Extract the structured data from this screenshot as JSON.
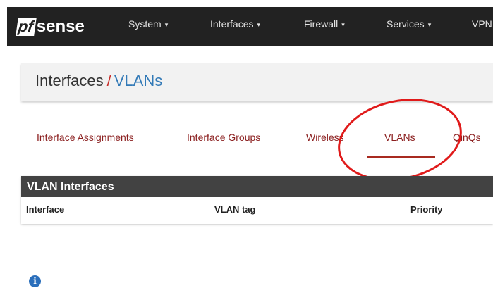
{
  "logo": {
    "part1": "pf",
    "part2": "sense"
  },
  "navbar": {
    "items": [
      {
        "label": "System",
        "has_caret": true
      },
      {
        "label": "Interfaces",
        "has_caret": true
      },
      {
        "label": "Firewall",
        "has_caret": true
      },
      {
        "label": "Services",
        "has_caret": true
      },
      {
        "label": "VPN",
        "has_caret": false
      }
    ],
    "caret": "▾"
  },
  "breadcrumb": {
    "section": "Interfaces",
    "separator": "/",
    "current": "VLANs"
  },
  "tabs": [
    {
      "label": "Interface Assignments",
      "active": false
    },
    {
      "label": "Interface Groups",
      "active": false
    },
    {
      "label": "Wireless",
      "active": false
    },
    {
      "label": "VLANs",
      "active": true
    },
    {
      "label": "QinQs",
      "active": false
    }
  ],
  "panel": {
    "title": "VLAN Interfaces",
    "columns": [
      "Interface",
      "VLAN tag",
      "Priority"
    ]
  },
  "info": {
    "icon": "info-icon",
    "glyph": "i"
  },
  "colors": {
    "navbar_bg": "#222222",
    "tab_text": "#8b1f1f",
    "active_underline": "#a82a20",
    "annotation": "#e01a1a",
    "crumb_link": "#337ab7",
    "panel_heading": "#424242"
  }
}
